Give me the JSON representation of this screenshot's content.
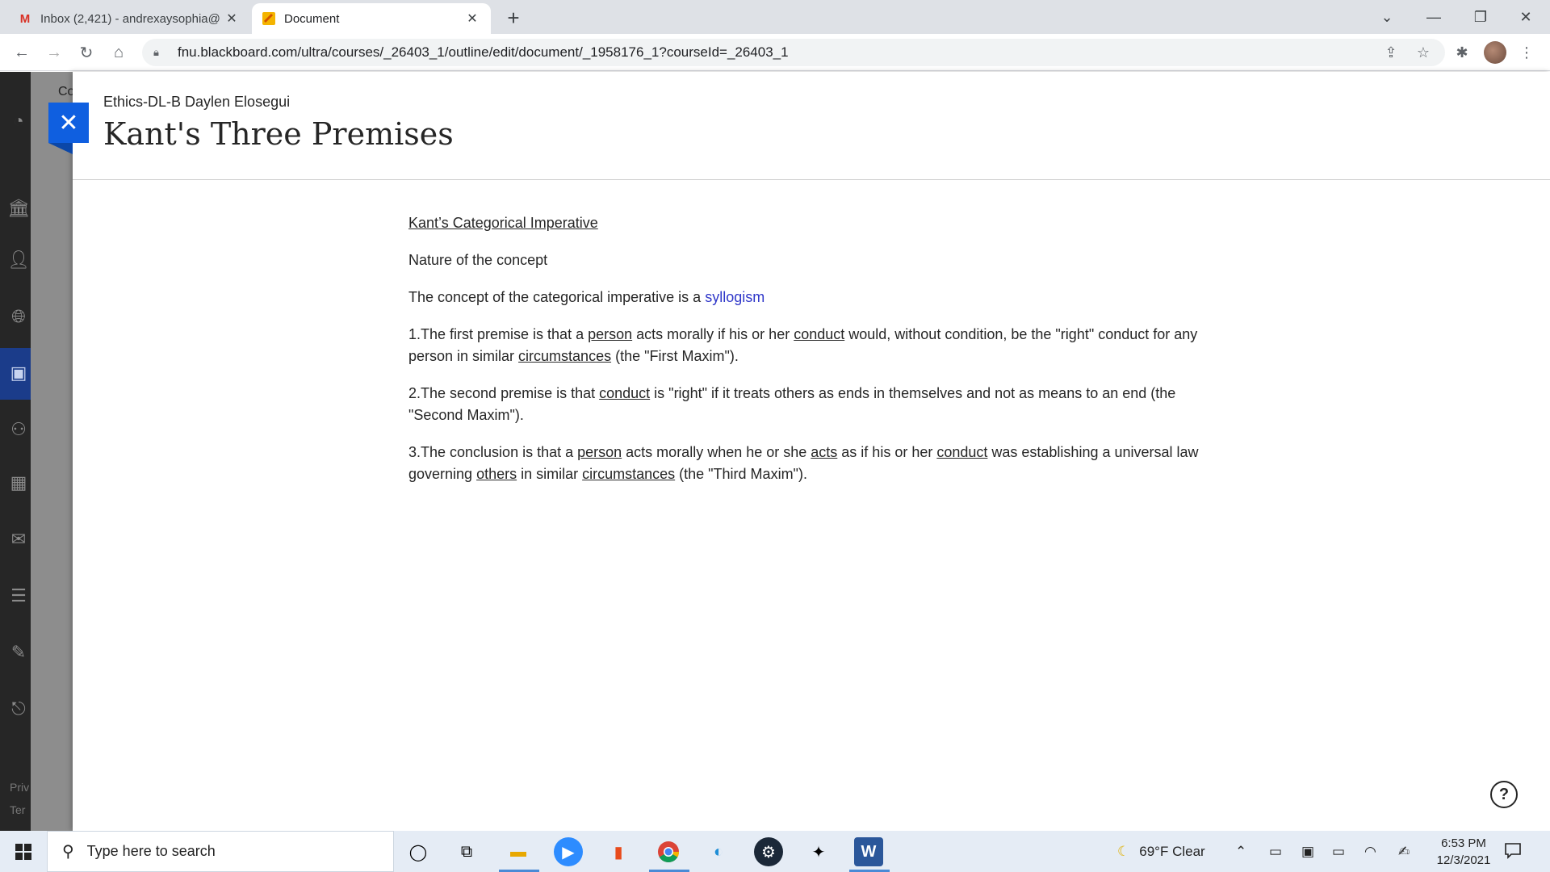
{
  "browser": {
    "tabs": [
      {
        "title": "Inbox (2,421) - andrexaysophia@",
        "icon": "gmail-icon",
        "active": false
      },
      {
        "title": "Document",
        "icon": "document-icon",
        "active": true
      }
    ],
    "url": "fnu.blackboard.com/ultra/courses/_26403_1/outline/edit/document/_1958176_1?courseId=_26403_1"
  },
  "background_page": {
    "partial_heading": "Co",
    "footer_1": "Priv",
    "footer_2": "Ter"
  },
  "panel": {
    "course_name": "Ethics-DL-B Daylen Elosegui",
    "title": "Kant's Three Premises"
  },
  "content": {
    "heading": "Kant’s Categorical Imperative",
    "subheading": "Nature of the concept",
    "intro_text": "The concept of the categorical imperative is a ",
    "intro_link": "syllogism",
    "p1": {
      "a": "1.The first premise is that a ",
      "u1": "person",
      "b": " acts morally if his or her ",
      "u2": "conduct",
      "c": " would, without condition, be the \"right\" conduct for any person in similar ",
      "u3": "circumstances",
      "d": " (the \"First Maxim\")."
    },
    "p2": {
      "a": "2.The second premise is that ",
      "u1": "conduct",
      "b": " is \"right\" if it treats others as ends in themselves and not as means to an end (the \"Second Maxim\")."
    },
    "p3": {
      "a": "3.The conclusion is that a ",
      "u1": "person",
      "b": " acts morally when he or she ",
      "u2": "acts",
      "c": " as if his or her ",
      "u3": "conduct",
      "d": " was establishing a universal law governing ",
      "u4": "others",
      "e": " in similar ",
      "u5": "circumstances",
      "f": " (the \"Third Maxim\")."
    }
  },
  "taskbar": {
    "search_placeholder": "Type here to search",
    "weather": "69°F  Clear",
    "time": "6:53 PM",
    "date": "12/3/2021"
  },
  "colors": {
    "accent_blue": "#0f5fe0",
    "link": "#2f37c9"
  }
}
